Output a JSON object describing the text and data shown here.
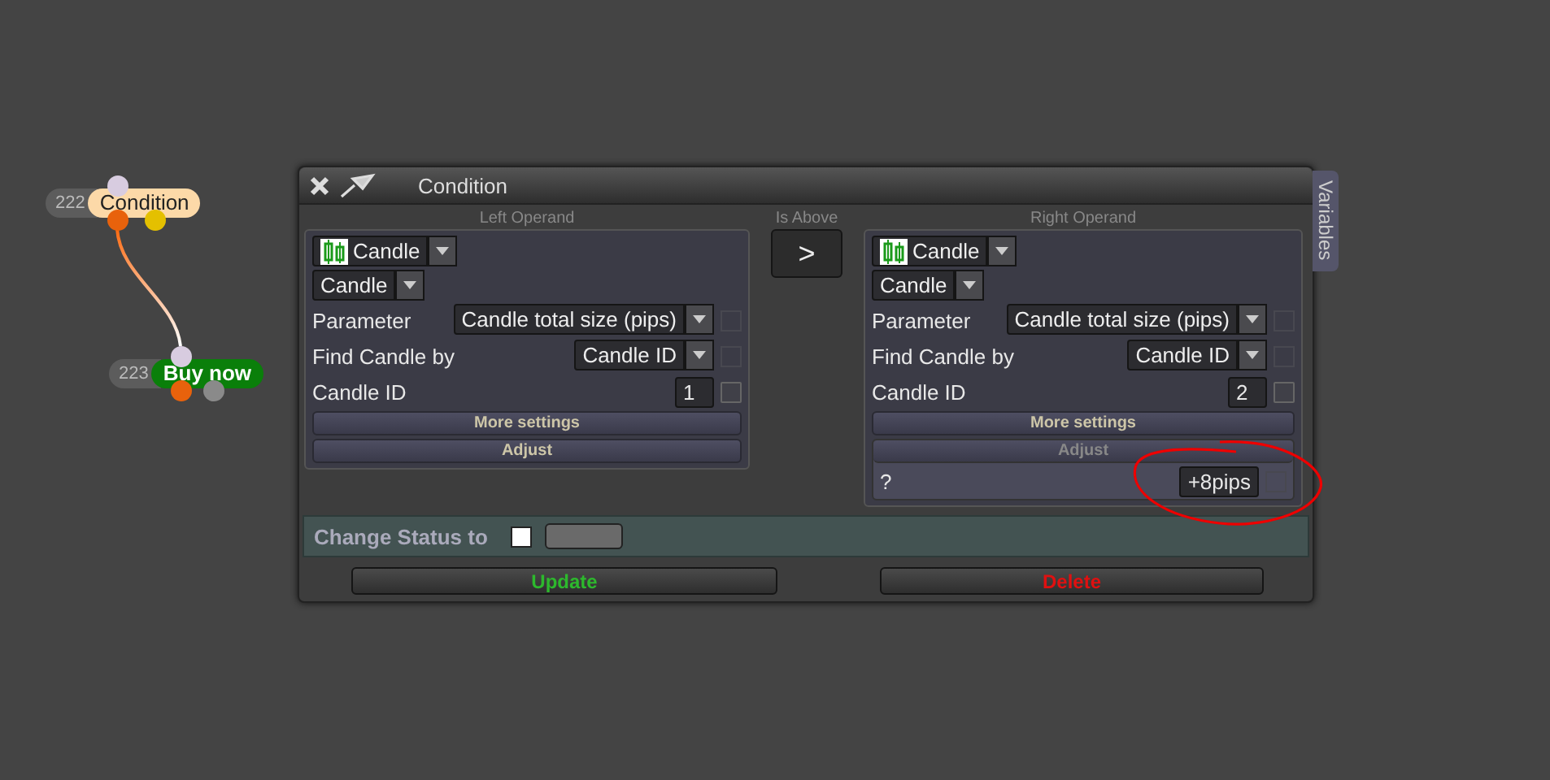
{
  "canvas": {
    "nodes": [
      {
        "number": "222",
        "title": "Condition",
        "kind": "condition"
      },
      {
        "number": "223",
        "title": "Buy now",
        "kind": "action"
      }
    ]
  },
  "dialog": {
    "title": "Condition",
    "side_tab": "Variables",
    "operands": [
      {
        "heading": "Left Operand",
        "source": "Candle",
        "type": "Candle",
        "rows": [
          {
            "kind": "select",
            "label": "Parameter",
            "value": "Candle total size (pips)",
            "disabled": true
          },
          {
            "kind": "select",
            "label": "Find Candle by",
            "value": "Candle ID",
            "disabled": true
          },
          {
            "kind": "input",
            "label": "Candle ID",
            "value": "1",
            "checked": false
          }
        ],
        "more_settings": "More settings",
        "adjust": {
          "label": "Adjust",
          "expanded": false
        }
      },
      {
        "heading": "Right Operand",
        "source": "Candle",
        "type": "Candle",
        "rows": [
          {
            "kind": "select",
            "label": "Parameter",
            "value": "Candle total size (pips)",
            "disabled": true
          },
          {
            "kind": "select",
            "label": "Find Candle by",
            "value": "Candle ID",
            "disabled": true
          },
          {
            "kind": "input",
            "label": "Candle ID",
            "value": "2",
            "checked": false
          }
        ],
        "more_settings": "More settings",
        "adjust": {
          "label": "Adjust",
          "expanded": true,
          "rows": [
            {
              "label": "?",
              "value": "+8pips",
              "disabled": true
            }
          ]
        }
      }
    ],
    "operator": {
      "heading": "Is Above",
      "symbol": ">"
    },
    "status": {
      "label": "Change Status to",
      "checked": false
    },
    "buttons": [
      {
        "label": "Update",
        "kind": "update"
      },
      {
        "label": "Delete",
        "kind": "delete"
      }
    ]
  }
}
